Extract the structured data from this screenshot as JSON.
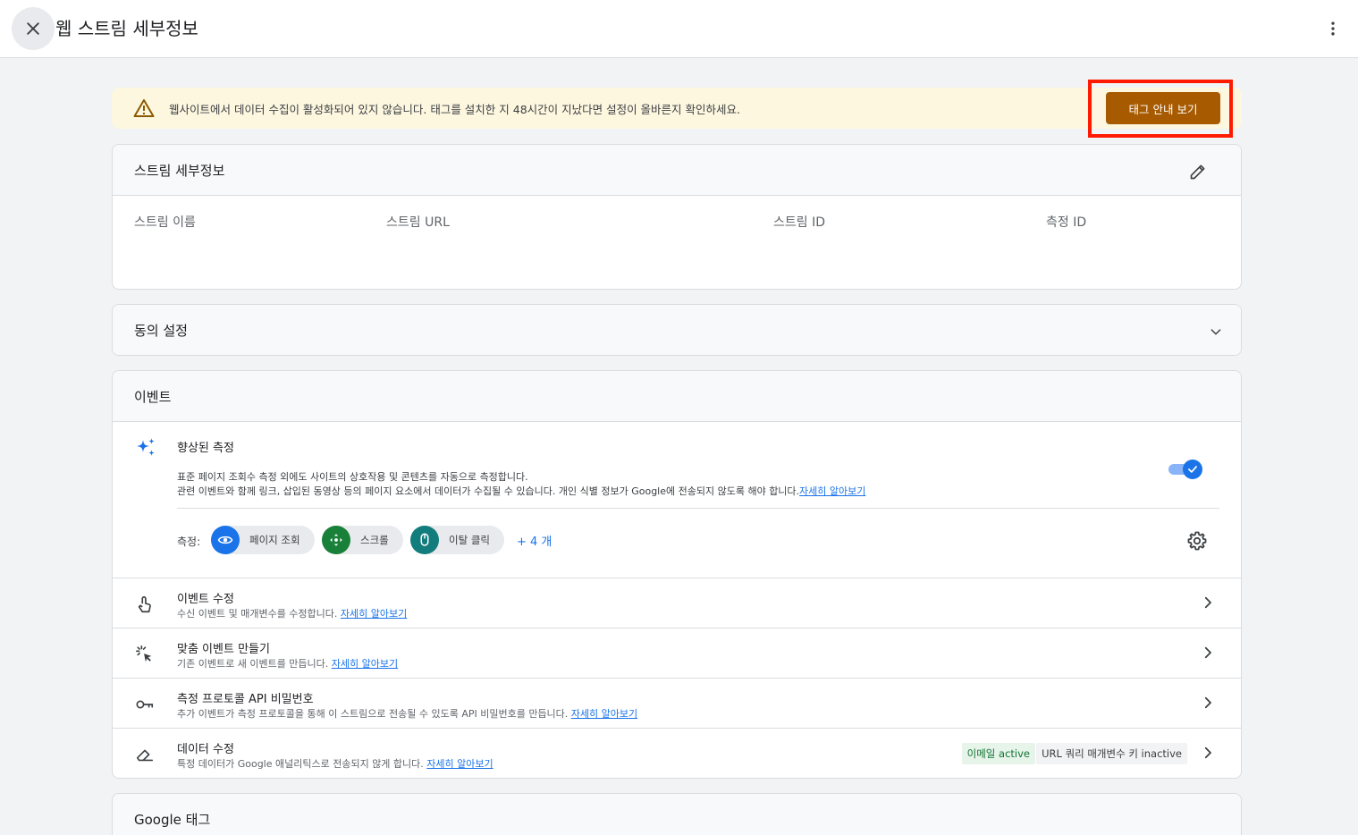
{
  "header": {
    "title": "웹 스트림 세부정보"
  },
  "banner": {
    "message": "웹사이트에서 데이터 수집이 활성화되어 있지 않습니다. 태그를 설치한 지 48시간이 지났다면 설정이 올바른지 확인하세요.",
    "button_label": "태그 안내 보기"
  },
  "stream_details": {
    "title": "스트림 세부정보",
    "columns": [
      "스트림 이름",
      "스트림 URL",
      "스트림 ID",
      "측정 ID"
    ]
  },
  "consent": {
    "title": "동의 설정"
  },
  "events": {
    "title": "이벤트",
    "enhanced": {
      "title": "향상된 측정",
      "desc1": "표준 페이지 조회수 측정 외에도 사이트의 상호작용 및 콘텐츠를 자동으로 측정합니다.",
      "desc2": "관련 이벤트와 함께 링크, 삽입된 동영상 등의 페이지 요소에서 데이터가 수집될 수 있습니다. 개인 식별 정보가 Google에 전송되지 않도록 해야 합니다.",
      "link": "자세히 알아보기",
      "toggle_on": true,
      "measurement_label": "측정:",
      "chips": [
        "페이지 조회",
        "스크롤",
        "이탈 클릭"
      ],
      "more": "+ 4 개"
    },
    "rows": [
      {
        "title": "이벤트 수정",
        "desc": "수신 이벤트 및 매개변수를 수정합니다.",
        "link": "자세히 알아보기"
      },
      {
        "title": "맞춤 이벤트 만들기",
        "desc": "기존 이벤트로 새 이벤트를 만듭니다.",
        "link": "자세히 알아보기"
      },
      {
        "title": "측정 프로토콜 API 비밀번호",
        "desc": "추가 이벤트가 측정 프로토콜을 통해 이 스트림으로 전송될 수 있도록 API 비밀번호를 만듭니다.",
        "link": "자세히 알아보기"
      },
      {
        "title": "데이터 수정",
        "desc": "특정 데이터가 Google 애널리틱스로 전송되지 않게 합니다.",
        "link": "자세히 알아보기",
        "badge_active": "이메일 active",
        "badge_inactive": "URL 쿼리 매개변수 키 inactive"
      }
    ]
  },
  "google_tag": {
    "title": "Google 태그"
  },
  "colors": {
    "primary": "#1a73e8",
    "banner_bg": "#fef7e0",
    "tag_button": "#a75a00",
    "highlight": "#ff1a00",
    "chip_eye": "#1a73e8",
    "chip_scroll": "#188038",
    "chip_click": "#137c7c"
  }
}
